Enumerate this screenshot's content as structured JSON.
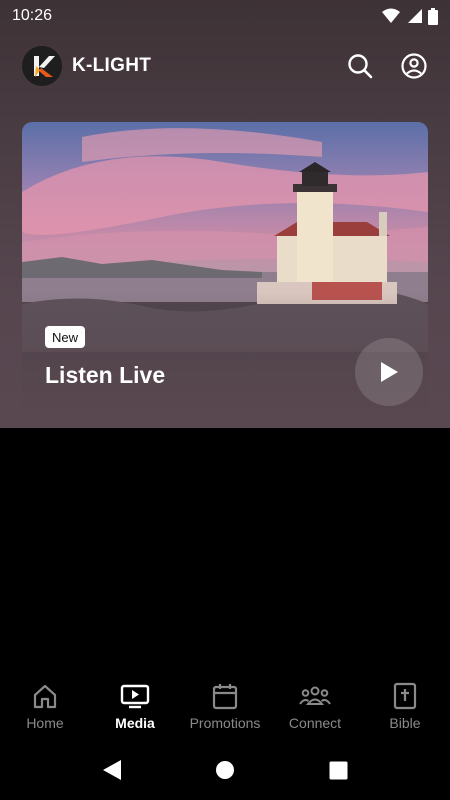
{
  "status_bar": {
    "time": "10:26"
  },
  "app": {
    "title": "K-LIGHT",
    "logo_letter": "K"
  },
  "header": {
    "search_icon": "search-icon",
    "account_icon": "account-icon"
  },
  "hero": {
    "badge": "New",
    "title": "Listen Live"
  },
  "bottom_nav": {
    "items": [
      {
        "label": "Home",
        "icon": "home-icon",
        "active": false
      },
      {
        "label": "Media",
        "icon": "media-icon",
        "active": true
      },
      {
        "label": "Promotions",
        "icon": "calendar-icon",
        "active": false
      },
      {
        "label": "Connect",
        "icon": "people-icon",
        "active": false
      },
      {
        "label": "Bible",
        "icon": "bible-icon",
        "active": false
      }
    ]
  },
  "colors": {
    "inactive": "#8a8a8a",
    "active": "#ffffff",
    "header_bg": "#4b3d44"
  }
}
